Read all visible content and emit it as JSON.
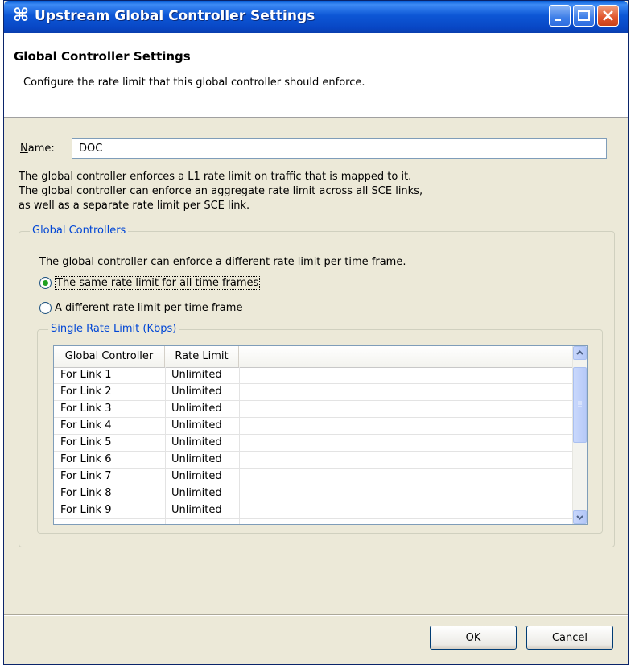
{
  "window": {
    "title": "Upstream Global Controller Settings",
    "icon": "cisco-app-icon"
  },
  "header": {
    "title": "Global Controller Settings",
    "description": "Configure the rate limit that this global controller should enforce."
  },
  "name_field": {
    "label_prefix": "N",
    "label_rest": "ame:",
    "value": "DOC"
  },
  "info_lines": [
    "The global controller enforces a L1 rate limit on traffic that is mapped to it.",
    "The global controller can enforce an aggregate rate limit across all SCE links,",
    "as well as a separate rate limit per SCE link."
  ],
  "global_controllers": {
    "legend": "Global Controllers",
    "description": "The global controller can enforce a different rate limit per time frame.",
    "option_same": {
      "before": "The ",
      "accel": "s",
      "after": "ame rate limit for all time frames",
      "selected": true
    },
    "option_different": {
      "before": "A ",
      "accel": "d",
      "after": "ifferent rate limit per time frame",
      "selected": false
    }
  },
  "rate_limit": {
    "legend": "Single Rate Limit (Kbps)",
    "columns": [
      "Global Controller",
      "Rate Limit"
    ],
    "rows": [
      [
        "For Link 1",
        "Unlimited"
      ],
      [
        "For Link 2",
        "Unlimited"
      ],
      [
        "For Link 3",
        "Unlimited"
      ],
      [
        "For Link 4",
        "Unlimited"
      ],
      [
        "For Link 5",
        "Unlimited"
      ],
      [
        "For Link 6",
        "Unlimited"
      ],
      [
        "For Link 7",
        "Unlimited"
      ],
      [
        "For Link 8",
        "Unlimited"
      ],
      [
        "For Link 9",
        "Unlimited"
      ]
    ]
  },
  "buttons": {
    "ok": "OK",
    "cancel": "Cancel"
  },
  "colors": {
    "titlebar": "#0846c4",
    "dialog_bg": "#ece9d8",
    "legend_text": "#0046d5",
    "radio_dot": "#21a121"
  }
}
